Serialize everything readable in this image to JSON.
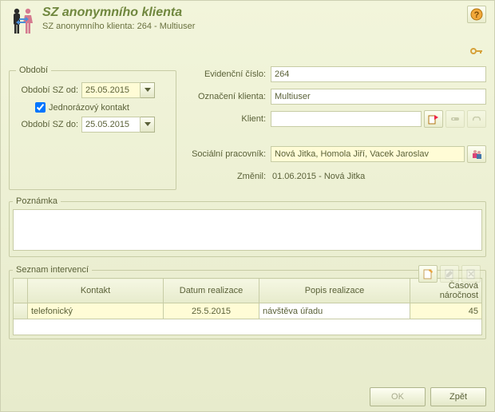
{
  "header": {
    "title": "SZ anonymního klienta",
    "subtitle": "SZ anonymního klienta: 264 - Multiuser"
  },
  "period": {
    "legend": "Období",
    "from_label": "Období SZ od:",
    "from_value": "25.05.2015",
    "single_contact_label": "Jednorázový kontakt",
    "single_contact_checked": true,
    "to_label": "Období SZ do:",
    "to_value": "25.05.2015"
  },
  "form": {
    "evidence_label": "Evidenční číslo:",
    "evidence_value": "264",
    "oznaceni_label": "Označení klienta:",
    "oznaceni_value": "Multiuser",
    "klient_label": "Klient:",
    "klient_value": "",
    "pracovnik_label": "Sociální pracovník:",
    "pracovnik_value": "Nová Jitka, Homola Jiří, Vacek Jaroslav",
    "zmenil_label": "Změnil:",
    "zmenil_value": "01.06.2015 - Nová Jitka"
  },
  "note": {
    "legend": "Poznámka",
    "value": ""
  },
  "interventions": {
    "legend": "Seznam intervencí",
    "columns": {
      "kontakt": "Kontakt",
      "datum": "Datum realizace",
      "popis": "Popis realizace",
      "cas": "Časová náročnost"
    },
    "rows": [
      {
        "kontakt": "telefonický",
        "datum": "25.5.2015",
        "popis": "návštěva úřadu",
        "cas": "45"
      }
    ]
  },
  "footer": {
    "ok": "OK",
    "back": "Zpět"
  }
}
